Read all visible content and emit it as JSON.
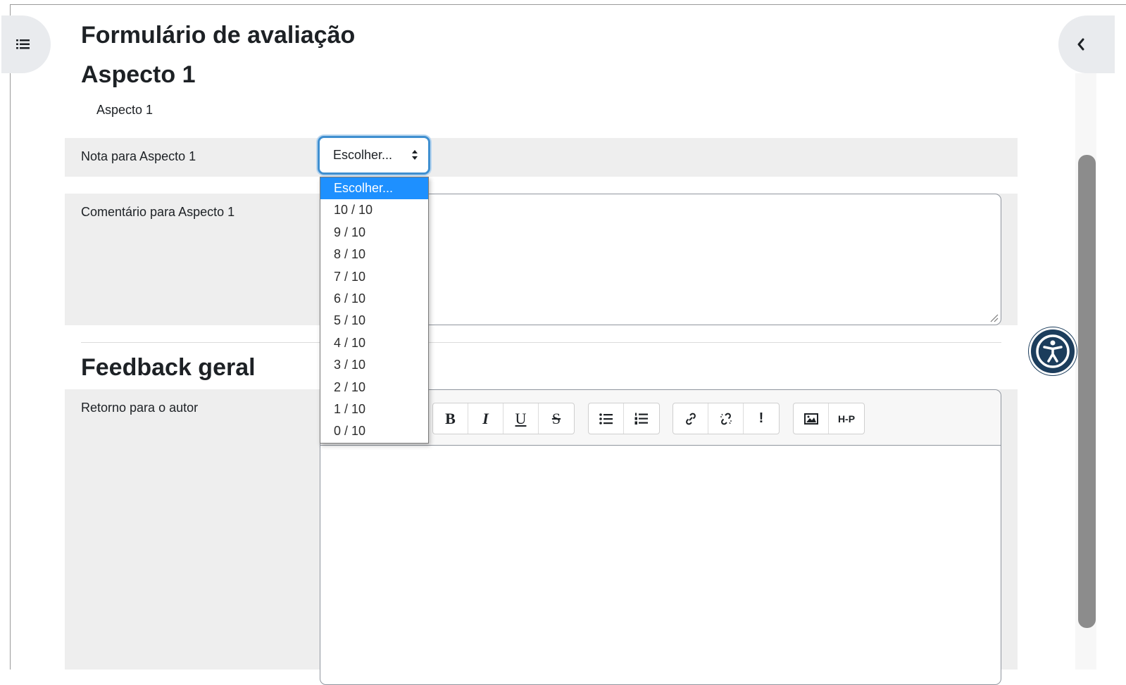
{
  "page": {
    "title": "Formulário de avaliação",
    "aspect_heading": "Aspecto 1",
    "aspect_description": "Aspecto 1"
  },
  "grade_field": {
    "label": "Nota para Aspecto 1",
    "selected": "Escolher...",
    "options": [
      "Escolher...",
      "10 / 10",
      "9 / 10",
      "8 / 10",
      "7 / 10",
      "6 / 10",
      "5 / 10",
      "4 / 10",
      "3 / 10",
      "2 / 10",
      "1 / 10",
      "0 / 10"
    ]
  },
  "comment_field": {
    "label": "Comentário para Aspecto 1",
    "value": ""
  },
  "feedback": {
    "heading": "Feedback geral",
    "label": "Retorno para o autor",
    "value": ""
  },
  "toolbar": {
    "bold": "B",
    "italic": "I",
    "underline": "U",
    "strike": "S",
    "unlink_symbol": "%",
    "exclaim": "!",
    "h5p": "H-P"
  },
  "colors": {
    "accent": "#1e90ff",
    "focus_border": "#3f8fd0",
    "row_background": "#eeeeee",
    "accessibility_button": "#1c3d5c"
  },
  "icons": {
    "drawer": "list-icon",
    "right_drawer": "chevron-left-icon",
    "accessibility": "accessibility-icon"
  }
}
